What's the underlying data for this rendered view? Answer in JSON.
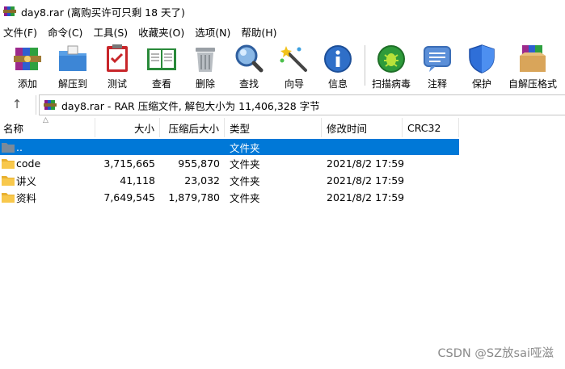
{
  "window": {
    "title": "day8.rar (离购买许可只剩 18 天了)"
  },
  "menu": [
    "文件(F)",
    "命令(C)",
    "工具(S)",
    "收藏夹(O)",
    "选项(N)",
    "帮助(H)"
  ],
  "toolbar": {
    "add": "添加",
    "extract": "解压到",
    "test": "测试",
    "view": "查看",
    "delete": "删除",
    "find": "查找",
    "wizard": "向导",
    "info": "信息",
    "scan": "扫描病毒",
    "comment": "注释",
    "protect": "保护",
    "sfx": "自解压格式"
  },
  "address": {
    "text": "day8.rar - RAR 压缩文件, 解包大小为 11,406,328 字节"
  },
  "columns": {
    "name": "名称",
    "size": "大小",
    "packed": "压缩后大小",
    "type": "类型",
    "modified": "修改时间",
    "crc": "CRC32"
  },
  "files": [
    {
      "name": "..",
      "size": "",
      "packed": "",
      "type": "文件夹",
      "modified": "",
      "crc": ""
    },
    {
      "name": "code",
      "size": "3,715,665",
      "packed": "955,870",
      "type": "文件夹",
      "modified": "2021/8/2 17:59",
      "crc": ""
    },
    {
      "name": "讲义",
      "size": "41,118",
      "packed": "23,032",
      "type": "文件夹",
      "modified": "2021/8/2 17:59",
      "crc": ""
    },
    {
      "name": "资料",
      "size": "7,649,545",
      "packed": "1,879,780",
      "type": "文件夹",
      "modified": "2021/8/2 17:59",
      "crc": ""
    }
  ],
  "watermark": "CSDN @SZ放sai哑滋",
  "colors": {
    "selection": "#0078d7",
    "folder": "#f8c84c"
  }
}
